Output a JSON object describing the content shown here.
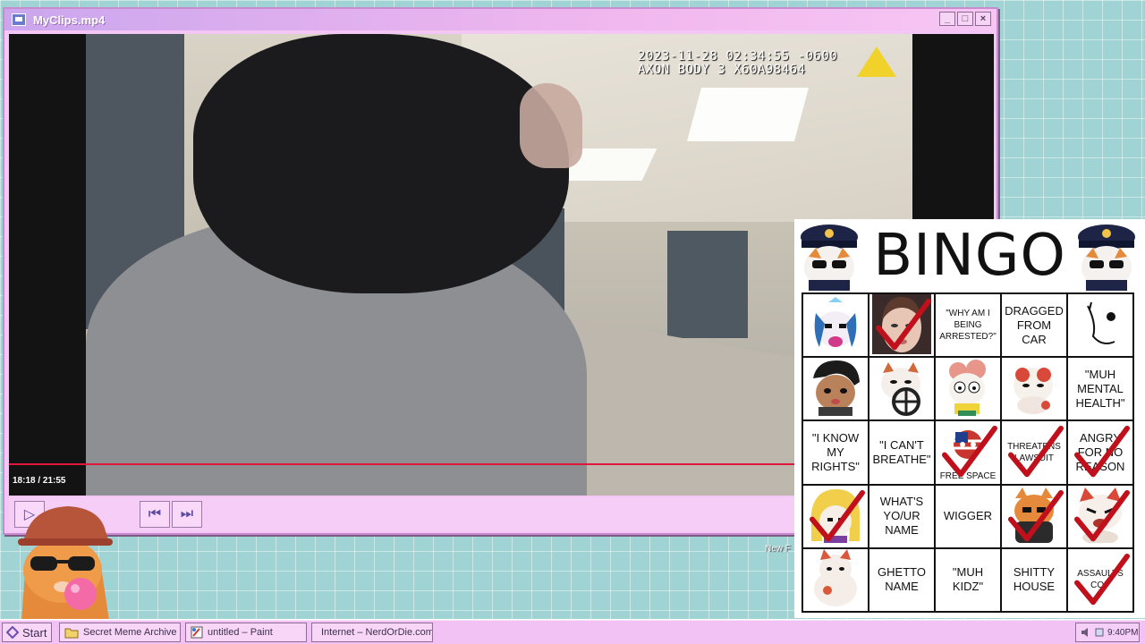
{
  "window": {
    "title": "MyClips.mp4",
    "controls": {
      "minimize": "_",
      "maximize": "□",
      "close": "×"
    }
  },
  "video": {
    "overlay_line1": "2023-11-28 02:34:55 -0600",
    "overlay_line2": "AXON BODY 3  X60A98464",
    "time": "18:18 / 21:55",
    "progress": 0.835
  },
  "player_controls": {
    "play": "▷",
    "prev": "⏮",
    "next": "⏭"
  },
  "desktop": {
    "partial_label": "New F"
  },
  "bingo": {
    "title": "BINGO",
    "cells": [
      {
        "text": "",
        "pic": "cat-unicorn",
        "checked": false
      },
      {
        "text": "",
        "pic": "woman-face",
        "checked": true
      },
      {
        "text": "\"WHY AM I BEING ARRESTED?\"",
        "small": true,
        "checked": false
      },
      {
        "text": "DRAGGED FROM CAR",
        "checked": false
      },
      {
        "text": "",
        "pic": "doodle",
        "checked": false
      },
      {
        "text": "",
        "pic": "cat-bangs",
        "checked": false
      },
      {
        "text": "",
        "pic": "cat-driver",
        "checked": false
      },
      {
        "text": "",
        "pic": "cat-pink-hair",
        "checked": false
      },
      {
        "text": "",
        "pic": "cat-red-spots",
        "checked": false
      },
      {
        "text": "\"MUH MENTAL HEALTH\"",
        "checked": false
      },
      {
        "text": "\"I KNOW MY RIGHTS\"",
        "checked": false
      },
      {
        "text": "\"I CAN'T BREATHE\"",
        "checked": false
      },
      {
        "text": "FREE SPACE",
        "small": true,
        "pic": "flag-ball",
        "checked": true
      },
      {
        "text": "THREATENS LAWSUIT",
        "small": true,
        "checked": true
      },
      {
        "text": "ANGRY FOR NO REASON",
        "checked": true
      },
      {
        "text": "",
        "pic": "cat-blonde",
        "checked": true
      },
      {
        "text": "WHAT'S YO/UR NAME",
        "checked": false
      },
      {
        "text": "WIGGER",
        "checked": false
      },
      {
        "text": "",
        "pic": "cat-dark",
        "checked": true
      },
      {
        "text": "",
        "pic": "cat-angry",
        "checked": true
      },
      {
        "text": "",
        "pic": "cat-sitting",
        "checked": false
      },
      {
        "text": "GHETTO NAME",
        "checked": false
      },
      {
        "text": "\"MUH KIDZ\"",
        "checked": false
      },
      {
        "text": "SHITTY HOUSE",
        "checked": false
      },
      {
        "text": "ASSAULTS COP",
        "small": true,
        "checked": true
      }
    ]
  },
  "taskbar": {
    "start_label": "Start",
    "tasks": [
      {
        "label": "Secret Meme Archive",
        "icon": "folder-icon"
      },
      {
        "label": "untitled – Paint",
        "icon": "paint-icon"
      },
      {
        "label": "Internet – NerdOrDie.com",
        "icon": "globe-icon"
      }
    ],
    "clock": "9:40PM"
  }
}
